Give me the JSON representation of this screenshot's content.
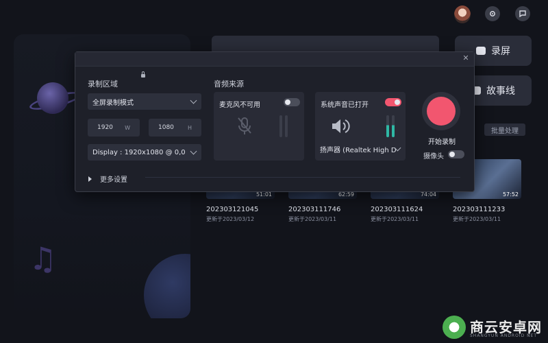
{
  "colors": {
    "background": "#12141b",
    "dialog": "#1e2029",
    "record_accent": "#f2566f",
    "toggle_on": "#f2566f",
    "toggle_off": "#4b4e5a"
  },
  "header": {
    "avatar_icon": "avatar",
    "icon1": "settings-icon",
    "icon2": "message-icon"
  },
  "sidebar": {
    "record_screen_label": "录屏",
    "storyline_label": "故事线",
    "batch_label": "批量处理"
  },
  "recordings": [
    {
      "name": "202303121045",
      "updated": "更新于2023/03/12",
      "duration": "51:01"
    },
    {
      "name": "202303111746",
      "updated": "更新于2023/03/11",
      "duration": "62:59"
    },
    {
      "name": "202303111624",
      "updated": "更新于2023/03/11",
      "duration": "74:04"
    },
    {
      "name": "202303111233",
      "updated": "更新于2023/03/11",
      "duration": "57:52"
    }
  ],
  "dialog": {
    "close_icon": "close-icon",
    "region": {
      "title": "录制区域",
      "mode": "全屏录制模式",
      "width": "1920",
      "width_unit": "W",
      "height": "1080",
      "height_unit": "H",
      "display": "Display : 1920x1080 @ 0,0"
    },
    "audio": {
      "title": "音频来源",
      "mic_label": "麦克风不可用",
      "mic_enabled": false,
      "system_label": "系统声音已打开",
      "system_enabled": true,
      "speaker_device": "扬声器 (Realtek High D"
    },
    "record": {
      "label": "开始录制",
      "camera_label": "摄像头",
      "camera_enabled": false
    },
    "more_settings": "更多设置"
  },
  "watermark": {
    "brand": "商云安卓网",
    "sub": "SHANGYUN ANDROID NET"
  }
}
